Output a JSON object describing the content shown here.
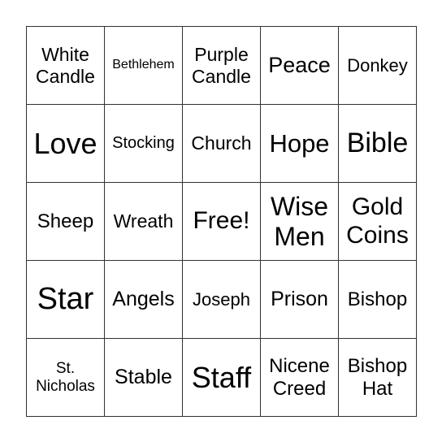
{
  "cells": [
    [
      "White Candle",
      "Bethlehem",
      "Purple Candle",
      "Peace",
      "Donkey"
    ],
    [
      "Love",
      "Stocking",
      "Church",
      "Hope",
      "Bible"
    ],
    [
      "Sheep",
      "Wreath",
      "Free!",
      "Wise Men",
      "Gold Coins"
    ],
    [
      "Star",
      "Angels",
      "Joseph",
      "Prison",
      "Bishop"
    ],
    [
      "St. Nicholas",
      "Stable",
      "Staff",
      "Nicene Creed",
      "Bishop Hat"
    ]
  ],
  "sizes": [
    [
      23,
      16,
      23,
      27,
      22
    ],
    [
      36,
      20,
      23,
      31,
      34
    ],
    [
      24,
      23,
      30,
      32,
      30
    ],
    [
      38,
      25,
      22,
      25,
      24
    ],
    [
      19,
      25,
      36,
      24,
      24
    ]
  ]
}
